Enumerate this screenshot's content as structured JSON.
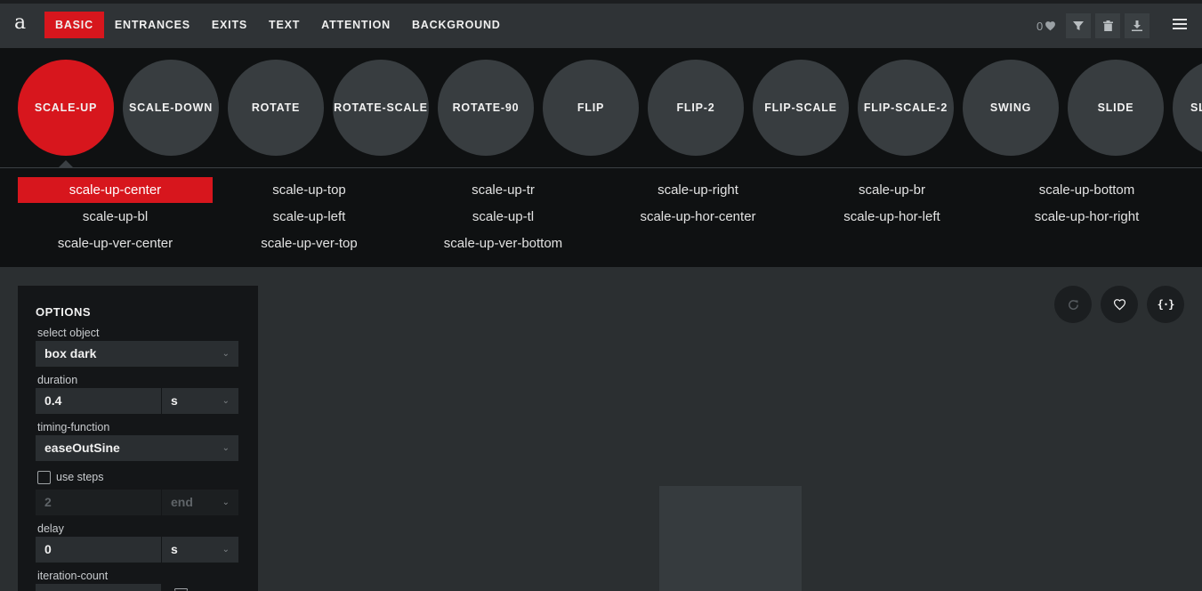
{
  "logo": "a",
  "nav": [
    {
      "label": "BASIC",
      "active": true
    },
    {
      "label": "ENTRANCES",
      "active": false
    },
    {
      "label": "EXITS",
      "active": false
    },
    {
      "label": "TEXT",
      "active": false
    },
    {
      "label": "ATTENTION",
      "active": false
    },
    {
      "label": "BACKGROUND",
      "active": false
    }
  ],
  "likes_count": "0",
  "toolbar_icons": [
    "heart-icon",
    "filter-icon",
    "trash-icon",
    "download-icon",
    "hamburger-menu-icon"
  ],
  "categories": [
    "SCALE-UP",
    "SCALE-DOWN",
    "ROTATE",
    "ROTATE-SCALE",
    "ROTATE-90",
    "FLIP",
    "FLIP-2",
    "FLIP-SCALE",
    "FLIP-SCALE-2",
    "SWING",
    "SLIDE",
    "SL"
  ],
  "selected_category": "SCALE-UP",
  "variants": [
    "scale-up-center",
    "scale-up-top",
    "scale-up-tr",
    "scale-up-right",
    "scale-up-br",
    "scale-up-bottom",
    "scale-up-bl",
    "scale-up-left",
    "scale-up-tl",
    "scale-up-hor-center",
    "scale-up-hor-left",
    "scale-up-hor-right",
    "scale-up-ver-center",
    "scale-up-ver-top",
    "scale-up-ver-bottom"
  ],
  "selected_variant": "scale-up-center",
  "options": {
    "title": "OPTIONS",
    "select_object": {
      "label": "select object",
      "value": "box dark"
    },
    "duration": {
      "label": "duration",
      "value": "0.4",
      "unit": "s"
    },
    "timing_function": {
      "label": "timing-function",
      "value": "easeOutSine"
    },
    "use_steps": {
      "label": "use steps",
      "checked": false,
      "steps": "2",
      "position": "end"
    },
    "delay": {
      "label": "delay",
      "value": "0",
      "unit": "s"
    },
    "iteration_count": {
      "label": "iteration-count"
    }
  },
  "stage_buttons": [
    "replay-icon",
    "favorite-icon",
    "code-icon"
  ],
  "colors": {
    "accent": "#d7161d",
    "dark_bg": "#0f1112",
    "panel_bg": "#141618",
    "stage_bg": "#2b2f31"
  }
}
